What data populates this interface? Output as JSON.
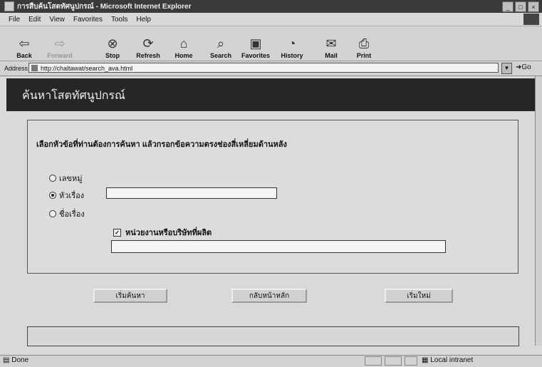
{
  "window": {
    "title": "การสืบค้นโสตทัศนูปกรณ์ - Microsoft Internet Explorer"
  },
  "menu": [
    "File",
    "Edit",
    "View",
    "Favorites",
    "Tools",
    "Help"
  ],
  "toolbar": [
    {
      "label": "Back",
      "icon": "back-arrow-icon"
    },
    {
      "label": "Forward",
      "icon": "forward-arrow-icon"
    },
    {
      "label": "Stop",
      "icon": "stop-icon"
    },
    {
      "label": "Refresh",
      "icon": "refresh-icon"
    },
    {
      "label": "Home",
      "icon": "home-icon"
    },
    {
      "label": "Search",
      "icon": "search-icon"
    },
    {
      "label": "Favorites",
      "icon": "favorites-icon"
    },
    {
      "label": "History",
      "icon": "history-icon"
    },
    {
      "label": "Mail",
      "icon": "mail-icon"
    },
    {
      "label": "Print",
      "icon": "print-icon"
    }
  ],
  "address": {
    "label": "Address",
    "url": "http://chaltawat/search_ava.html",
    "go": "Go"
  },
  "banner": {
    "title": "ค้นหาโสตทัศนูปกรณ์"
  },
  "form": {
    "instruction": "เลือกหัวข้อที่ท่านต้องการค้นหา แล้วกรอกข้อความตรงช่องสี่เหลี่ยมด้านหลัง",
    "options": [
      {
        "label": "เลขหมู่",
        "selected": false
      },
      {
        "label": "หัวเรื่อง",
        "selected": true
      },
      {
        "label": "ชื่อเรื่อง",
        "selected": false
      }
    ],
    "search_value": "",
    "checkbox_label": "หน่วยงานหรือบริษัทที่ผลิต",
    "checkbox_checked": true,
    "producer_value": ""
  },
  "buttons": {
    "search": "เริ่มค้นหา",
    "home": "กลับหน้าหลัก",
    "reset": "เริ่มใหม่"
  },
  "status": {
    "text": "Done",
    "zone": "Local intranet"
  }
}
